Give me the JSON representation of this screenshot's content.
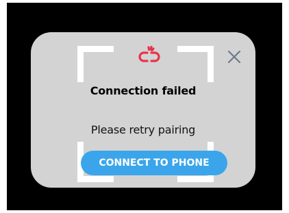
{
  "dialog": {
    "title": "Connection failed",
    "message": "Please retry pairing",
    "primary_button_label": "CONNECT TO PHONE",
    "status_icon": "broken-link-icon",
    "close_icon": "close-icon"
  },
  "colors": {
    "screen_background": "#000000",
    "dialog_background": "#d3d3d3",
    "frame_brackets": "#ffffff",
    "error_icon": "#e8334a",
    "close_icon": "#6b7a8a",
    "button_background": "#3aa5ea",
    "button_text": "#ffffff"
  }
}
